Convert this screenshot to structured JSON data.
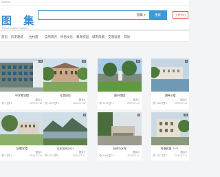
{
  "site_label": "Archive",
  "header": {
    "logo_title": "图 集",
    "logo_sub": "Picture Gallery Platform",
    "search_placeholder": "",
    "search_type": "图集",
    "search_button": "搜索",
    "upload_button": "上传中心"
  },
  "nav": [
    "首页",
    "历史建筑",
    "古村落",
    "自然风光",
    "民俗文化",
    "教育校园",
    "城市风貌",
    "交通设施",
    "其他"
  ],
  "cards": [
    {
      "title": "中学教学楼",
      "author": "图友A",
      "views": "1",
      "comments": "0",
      "date": "2019-07-18",
      "count": "10"
    },
    {
      "title": "礼堂旧址",
      "author": "图友B",
      "views": "1057",
      "comments": "1",
      "date": "2019-07-14",
      "count": "19"
    },
    {
      "title": "图书馆楼",
      "author": "图友C",
      "views": "1213",
      "comments": "1",
      "date": "2019-07-13",
      "count": "80"
    },
    {
      "title": "湖畔小楼",
      "author": "图友D",
      "views": "1169",
      "comments": "1",
      "date": "2019-07-12",
      "count": "5"
    },
    {
      "title": "旧教学楼",
      "author": "图友E",
      "views": "4",
      "comments": "1",
      "date": "2019-07-12",
      "count": ""
    },
    {
      "title": "山水风光2021",
      "author": "图友F",
      "views": "1171",
      "comments": "1",
      "date": "2019-07-11",
      "count": "8"
    },
    {
      "title": "石桥与水车",
      "author": "图友G",
      "views": "1064",
      "comments": "0",
      "date": "2019-07-11",
      "count": "4"
    },
    {
      "title": "村落民居（一）",
      "author": "图友H",
      "views": "1057",
      "comments": "1",
      "date": "2019-07-11",
      "count": "12"
    }
  ],
  "icons": {
    "eye": "eye-icon",
    "comment": "comment-icon"
  }
}
